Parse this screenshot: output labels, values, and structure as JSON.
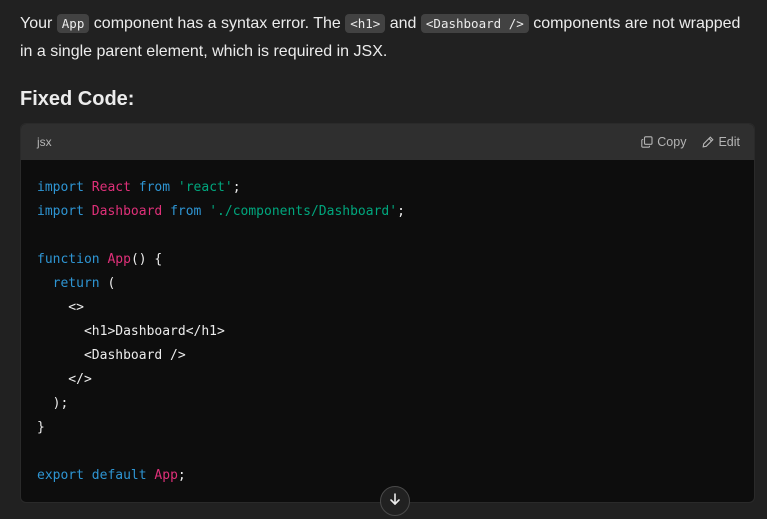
{
  "explanation": {
    "part1": "Your ",
    "code1": "App",
    "part2": " component has a syntax error. The ",
    "code2": "<h1>",
    "part3": " and ",
    "code3": "<Dashboard />",
    "part4": " components are not wrapped in a single parent element, which is required in JSX."
  },
  "heading": "Fixed Code:",
  "code_block": {
    "language": "jsx",
    "copy_label": "Copy",
    "edit_label": "Edit",
    "lines": {
      "l1": {
        "a": "import",
        "b": " ",
        "c": "React",
        "d": " ",
        "e": "from",
        "f": " ",
        "g": "'react'",
        "h": ";"
      },
      "l2": {
        "a": "import",
        "b": " ",
        "c": "Dashboard",
        "d": " ",
        "e": "from",
        "f": " ",
        "g": "'./components/Dashboard'",
        "h": ";"
      },
      "l4": {
        "a": "function",
        "b": " ",
        "c": "App",
        "d": "() {"
      },
      "l5": {
        "a": "  ",
        "b": "return",
        "c": " ("
      },
      "l6": "    <>",
      "l7": "      <h1>Dashboard</h1>",
      "l8": "      <Dashboard />",
      "l9": "    </>",
      "l10": "  );",
      "l11": "}",
      "l13": {
        "a": "export",
        "b": " ",
        "c": "default",
        "d": " ",
        "e": "App",
        "f": ";"
      }
    }
  },
  "icons": {
    "copy": "copy-icon",
    "edit": "pencil-icon",
    "scroll": "arrow-down-icon"
  }
}
